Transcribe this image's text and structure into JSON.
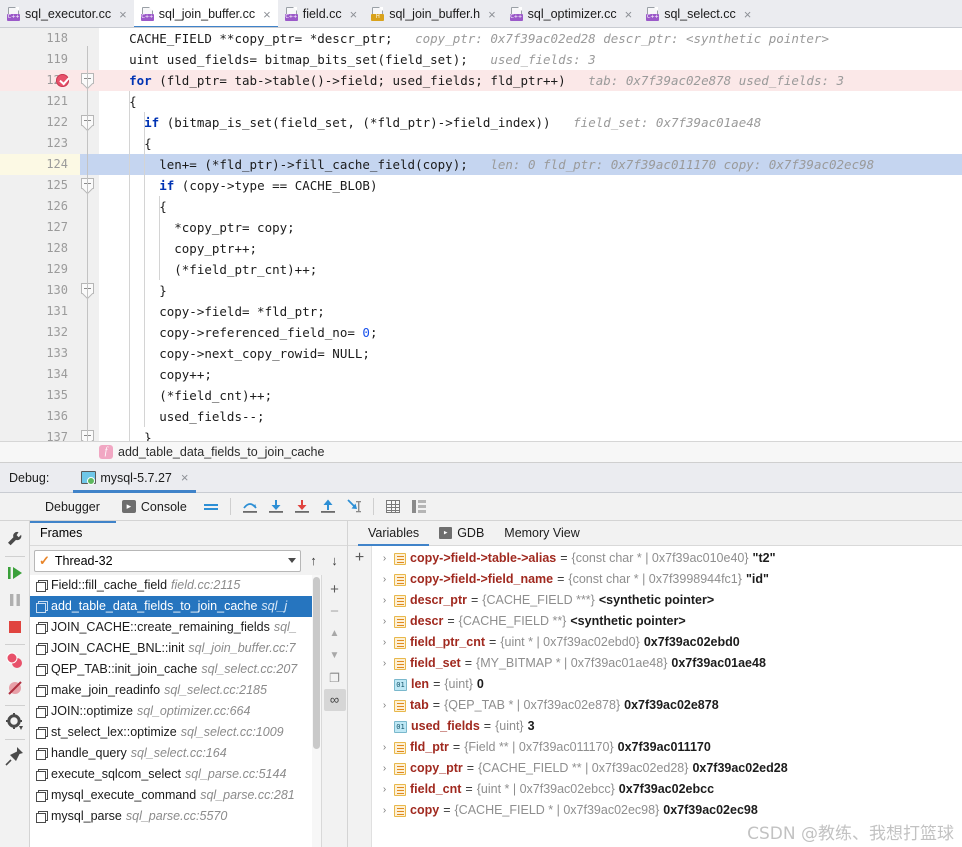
{
  "editor_tabs": [
    {
      "label": "sql_executor.cc",
      "icon": "cpp-file-icon",
      "active": false
    },
    {
      "label": "sql_join_buffer.cc",
      "icon": "cpp-file-icon",
      "active": true
    },
    {
      "label": "field.cc",
      "icon": "cpp-file-icon",
      "active": false
    },
    {
      "label": "sql_join_buffer.h",
      "icon": "header-file-icon",
      "active": false
    },
    {
      "label": "sql_optimizer.cc",
      "icon": "cpp-file-icon",
      "active": false
    },
    {
      "label": "sql_select.cc",
      "icon": "cpp-file-icon",
      "active": false
    }
  ],
  "close_glyph": "×",
  "code_lines": [
    {
      "num": "118",
      "indent": 4,
      "code": "CACHE_FIELD **copy_ptr= *descr_ptr;",
      "hint": "copy_ptr: 0x7f39ac02ed28     descr_ptr: <synthetic pointer>",
      "state": ""
    },
    {
      "num": "119",
      "indent": 4,
      "code": "uint used_fields= bitmap_bits_set(field_set);",
      "hint": "used_fields: 3",
      "state": ""
    },
    {
      "num": "120",
      "indent": 4,
      "code": "for (fld_ptr= tab->table()->field; used_fields; fld_ptr++)",
      "hint": "tab: 0x7f39ac02e878     used_fields: 3",
      "state": "bp",
      "keyword": "for",
      "breakpoint": true,
      "fold": true
    },
    {
      "num": "121",
      "indent": 4,
      "code": "{",
      "hint": "",
      "state": ""
    },
    {
      "num": "122",
      "indent": 6,
      "code": "if (bitmap_is_set(field_set, (*fld_ptr)->field_index))",
      "hint": "field_set: 0x7f39ac01ae48",
      "state": "",
      "keyword": "if",
      "fold": true
    },
    {
      "num": "123",
      "indent": 6,
      "code": "{",
      "hint": "",
      "state": ""
    },
    {
      "num": "124",
      "indent": 8,
      "code": "len+= (*fld_ptr)->fill_cache_field(copy);",
      "hint": "len: 0     fld_ptr: 0x7f39ac011170     copy: 0x7f39ac02ec98",
      "state": "exec"
    },
    {
      "num": "125",
      "indent": 8,
      "code": "if (copy->type == CACHE_BLOB)",
      "hint": "",
      "state": "",
      "keyword": "if",
      "fold": true
    },
    {
      "num": "126",
      "indent": 8,
      "code": "{",
      "hint": "",
      "state": ""
    },
    {
      "num": "127",
      "indent": 10,
      "code": "*copy_ptr= copy;",
      "hint": "",
      "state": ""
    },
    {
      "num": "128",
      "indent": 10,
      "code": "copy_ptr++;",
      "hint": "",
      "state": ""
    },
    {
      "num": "129",
      "indent": 10,
      "code": "(*field_ptr_cnt)++;",
      "hint": "",
      "state": ""
    },
    {
      "num": "130",
      "indent": 8,
      "code": "}",
      "hint": "",
      "state": "",
      "fold": true
    },
    {
      "num": "131",
      "indent": 8,
      "code": "copy->field= *fld_ptr;",
      "hint": "",
      "state": ""
    },
    {
      "num": "132",
      "indent": 8,
      "code": "copy->referenced_field_no= 0;",
      "hint": "",
      "state": "",
      "zero": true
    },
    {
      "num": "133",
      "indent": 8,
      "code": "copy->next_copy_rowid= NULL;",
      "hint": "",
      "state": ""
    },
    {
      "num": "134",
      "indent": 8,
      "code": "copy++;",
      "hint": "",
      "state": ""
    },
    {
      "num": "135",
      "indent": 8,
      "code": "(*field_cnt)++;",
      "hint": "",
      "state": ""
    },
    {
      "num": "136",
      "indent": 8,
      "code": "used_fields--;",
      "hint": "",
      "state": ""
    },
    {
      "num": "137",
      "indent": 6,
      "code": "}",
      "hint": "",
      "state": "",
      "fold": true
    }
  ],
  "breadcrumb": {
    "icon": "function-icon",
    "icon_glyph": "f",
    "label": "add_table_data_fields_to_join_cache"
  },
  "debug_header": {
    "label": "Debug:",
    "session_tab": "mysql-5.7.27",
    "session_icon": "run-config-icon",
    "close_glyph": "×"
  },
  "debug_toolbar": {
    "rerun_icon": "rerun-icon",
    "tabs": [
      {
        "label": "Debugger",
        "icon": "",
        "active": true
      },
      {
        "label": "Console",
        "icon": "console-icon",
        "active": false
      }
    ],
    "buttons": [
      {
        "name": "show-executed-lines-icon",
        "title": "Show Execution Point"
      },
      {
        "name": "step-over-icon",
        "title": "Step Over"
      },
      {
        "name": "step-into-icon",
        "title": "Step Into"
      },
      {
        "name": "force-step-into-icon",
        "title": "Force Step Into"
      },
      {
        "name": "step-out-icon",
        "title": "Step Out"
      },
      {
        "name": "run-to-cursor-icon",
        "title": "Run to Cursor"
      },
      {
        "name": "evaluate-expression-icon",
        "title": "Evaluate Expression"
      },
      {
        "name": "layout-settings-icon",
        "title": "Layout"
      }
    ]
  },
  "left_rail": [
    {
      "name": "settings-wrench-icon"
    },
    {
      "name": "resume-program-icon"
    },
    {
      "name": "pause-program-icon"
    },
    {
      "name": "stop-icon"
    },
    {
      "name": "view-breakpoints-icon"
    },
    {
      "name": "mute-breakpoints-icon"
    },
    {
      "name": "debugger-settings-gear-icon"
    },
    {
      "name": "pin-tab-icon"
    }
  ],
  "frames_panel": {
    "title": "Frames",
    "thread": {
      "label": "Thread-32",
      "check_glyph": "✓"
    },
    "up_glyph": "↑",
    "down_glyph": "↓",
    "frames": [
      {
        "fn": "Field::fill_cache_field",
        "loc": "field.cc:2115",
        "selected": false
      },
      {
        "fn": "add_table_data_fields_to_join_cache",
        "loc": "sql_j",
        "selected": true
      },
      {
        "fn": "JOIN_CACHE::create_remaining_fields",
        "loc": "sql_",
        "selected": false
      },
      {
        "fn": "JOIN_CACHE_BNL::init",
        "loc": "sql_join_buffer.cc:7",
        "selected": false
      },
      {
        "fn": "QEP_TAB::init_join_cache",
        "loc": "sql_select.cc:207",
        "selected": false
      },
      {
        "fn": "make_join_readinfo",
        "loc": "sql_select.cc:2185",
        "selected": false
      },
      {
        "fn": "JOIN::optimize",
        "loc": "sql_optimizer.cc:664",
        "selected": false
      },
      {
        "fn": "st_select_lex::optimize",
        "loc": "sql_select.cc:1009",
        "selected": false
      },
      {
        "fn": "handle_query",
        "loc": "sql_select.cc:164",
        "selected": false
      },
      {
        "fn": "execute_sqlcom_select",
        "loc": "sql_parse.cc:5144",
        "selected": false
      },
      {
        "fn": "mysql_execute_command",
        "loc": "sql_parse.cc:281",
        "selected": false
      },
      {
        "fn": "mysql_parse",
        "loc": "sql_parse.cc:5570",
        "selected": false
      }
    ],
    "side_buttons": [
      {
        "name": "add-watch-icon",
        "glyph": "+"
      },
      {
        "name": "remove-watch-icon",
        "glyph": "−"
      },
      {
        "name": "move-up-icon",
        "glyph": "▲"
      },
      {
        "name": "move-down-icon",
        "glyph": "▼"
      },
      {
        "name": "copy-stack-icon",
        "glyph": "❐"
      },
      {
        "name": "binoculars-icon",
        "glyph": "∞"
      }
    ]
  },
  "variables_panel": {
    "tabs": [
      {
        "label": "Variables",
        "icon": "",
        "active": true
      },
      {
        "label": "GDB",
        "icon": "gdb-console-icon",
        "active": false
      },
      {
        "label": "Memory View",
        "icon": "",
        "active": false
      }
    ],
    "add_glyph": "+",
    "chevron_glyph": "›",
    "rows": [
      {
        "name": "copy->field->table->alias",
        "type": "{const char * | 0x7f39ac010e40}",
        "value": "\"t2\"",
        "kind": "struct",
        "expandable": true
      },
      {
        "name": "copy->field->field_name",
        "type": "{const char * | 0x7f3998944fc1}",
        "value": "\"id\"",
        "kind": "struct",
        "expandable": true
      },
      {
        "name": "descr_ptr",
        "type": "{CACHE_FIELD ***}",
        "value": "<synthetic pointer>",
        "kind": "struct",
        "expandable": true
      },
      {
        "name": "descr",
        "type": "{CACHE_FIELD **}",
        "value": "<synthetic pointer>",
        "kind": "struct",
        "expandable": true
      },
      {
        "name": "field_ptr_cnt",
        "type": "{uint * | 0x7f39ac02ebd0}",
        "value": "0x7f39ac02ebd0",
        "kind": "struct",
        "expandable": true
      },
      {
        "name": "field_set",
        "type": "{MY_BITMAP * | 0x7f39ac01ae48}",
        "value": "0x7f39ac01ae48",
        "kind": "struct",
        "expandable": true
      },
      {
        "name": "len",
        "type": "{uint}",
        "value": "0",
        "kind": "prim",
        "expandable": false,
        "prim_glyph": "01"
      },
      {
        "name": "tab",
        "type": "{QEP_TAB * | 0x7f39ac02e878}",
        "value": "0x7f39ac02e878",
        "kind": "struct",
        "expandable": true
      },
      {
        "name": "used_fields",
        "type": "{uint}",
        "value": "3",
        "kind": "prim",
        "expandable": false,
        "prim_glyph": "01"
      },
      {
        "name": "fld_ptr",
        "type": "{Field ** | 0x7f39ac011170}",
        "value": "0x7f39ac011170",
        "kind": "struct",
        "expandable": true
      },
      {
        "name": "copy_ptr",
        "type": "{CACHE_FIELD ** | 0x7f39ac02ed28}",
        "value": "0x7f39ac02ed28",
        "kind": "struct",
        "expandable": true
      },
      {
        "name": "field_cnt",
        "type": "{uint * | 0x7f39ac02ebcc}",
        "value": "0x7f39ac02ebcc",
        "kind": "struct",
        "expandable": true
      },
      {
        "name": "copy",
        "type": "{CACHE_FIELD * | 0x7f39ac02ec98}",
        "value": "0x7f39ac02ec98",
        "kind": "struct",
        "expandable": true
      }
    ]
  },
  "watermark": "CSDN @教练、我想打篮球",
  "colors": {
    "accent": "#4083c9",
    "selection": "#2675bf",
    "exec_line": "#c5d5f0",
    "breakpoint_line": "#fbe8e8",
    "breakpoint": "#e8516a",
    "var_name": "#a0291f",
    "keyword": "#0033b3"
  }
}
